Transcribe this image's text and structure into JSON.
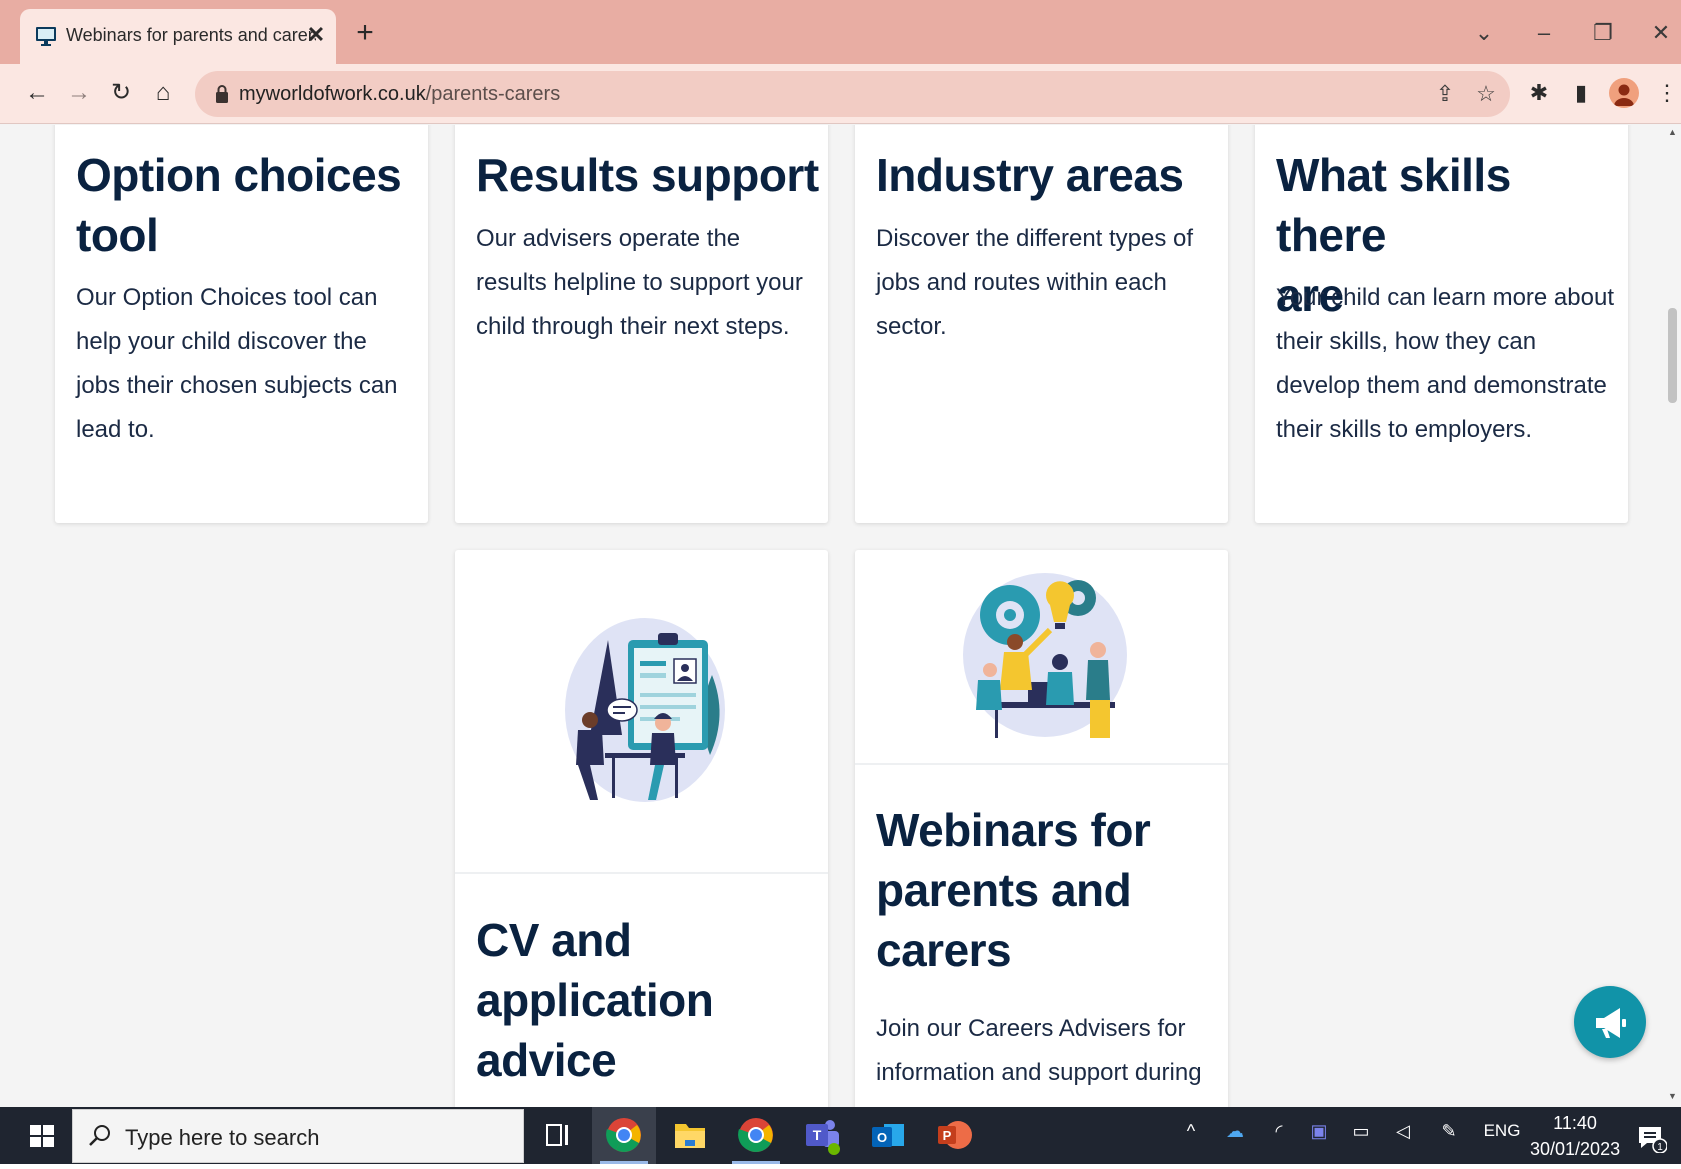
{
  "browser": {
    "tab_title": "Webinars for parents and carers |",
    "url_domain": "myworldofwork.co.uk",
    "url_path": "/parents-carers"
  },
  "cards": {
    "option_choices": {
      "title_line1": "Option choices",
      "title_line2": "tool",
      "desc_lines": [
        "Our Option Choices tool can",
        "help your child discover the",
        "jobs their chosen subjects can",
        "lead to."
      ]
    },
    "results_support": {
      "title_line1": "Results support",
      "desc_lines": [
        "Our advisers operate the",
        "results helpline to support your",
        "child through their next steps."
      ]
    },
    "industry_areas": {
      "title_line1": "Industry areas",
      "desc_lines": [
        "Discover the different types of",
        "jobs and routes within each",
        "sector."
      ]
    },
    "skills": {
      "title_line1": "What skills there",
      "title_line2": "are",
      "desc_lines": [
        "Your child can learn more about",
        "their skills, how they can",
        "develop them and demonstrate",
        "their skills to employers."
      ]
    },
    "cv_advice": {
      "title_lines": [
        "CV and",
        "application",
        "advice"
      ]
    },
    "webinars": {
      "title_lines": [
        "Webinars for",
        "parents and",
        "carers"
      ],
      "desc_lines": [
        "Join our Careers Advisers for",
        "information and support during"
      ]
    }
  },
  "taskbar": {
    "search_placeholder": "Type here to search",
    "language": "ENG",
    "time": "11:40",
    "date": "30/01/2023",
    "notification_count": "1"
  },
  "colors": {
    "heading": "#0a2240",
    "body_text": "#1b2a44",
    "accent": "#1193a8",
    "tab_strip": "#e8ada3"
  }
}
